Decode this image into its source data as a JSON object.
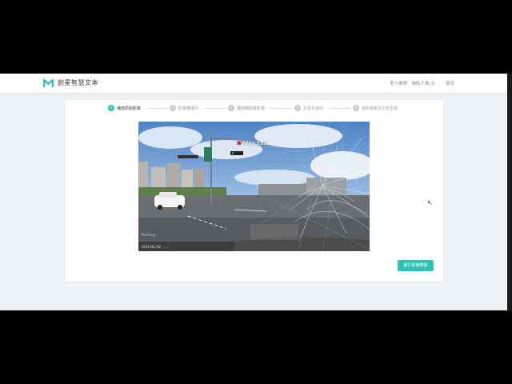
{
  "header": {
    "brand": "創星智慧文本",
    "user": "登入帳號：場點人員 01",
    "logout": "登出"
  },
  "steps": [
    {
      "num": "1",
      "label": "播放原始影像",
      "active": true
    },
    {
      "num": "2",
      "label": "影像轉換中",
      "active": false
    },
    {
      "num": "3",
      "label": "播放轉換後影像",
      "active": false
    },
    {
      "num": "4",
      "label": "文本生成中",
      "active": false
    },
    {
      "num": "5",
      "label": "資料更新及文本生成",
      "active": false
    }
  ],
  "video": {
    "watermark_prefix": "W",
    "watermark_rest": "OW!schout",
    "osd_line1": "Parking",
    "osd_line2": "2024/01/02 ..."
  },
  "actions": {
    "convert_label": "進行影像轉換"
  },
  "colors": {
    "accent": "#2cc2b5",
    "background": "#eef2f5"
  }
}
